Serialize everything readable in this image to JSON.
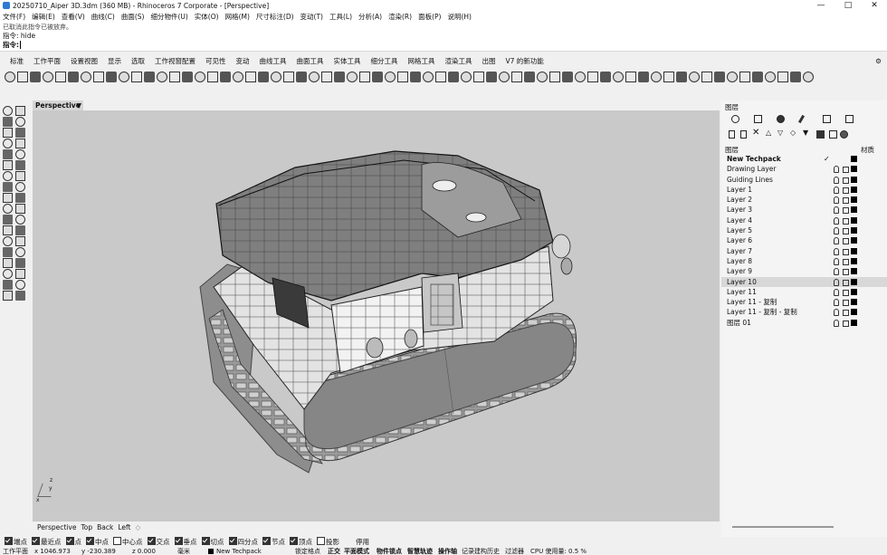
{
  "window": {
    "title": "20250710_Aiper 3D.3dm (360 MB) - Rhinoceros 7 Corporate - [Perspective]",
    "minimize": "—",
    "maximize": "□",
    "close": "✕"
  },
  "menu": [
    "文件(F)",
    "编辑(E)",
    "查看(V)",
    "曲线(C)",
    "曲面(S)",
    "细分物件(U)",
    "实体(O)",
    "网格(M)",
    "尺寸标注(D)",
    "变动(T)",
    "工具(L)",
    "分析(A)",
    "渲染(R)",
    "面板(P)",
    "说明(H)"
  ],
  "command": {
    "history": "已取消此指令已被放弃。",
    "last_label": "指令:",
    "last_value": "hide",
    "prompt_label": "指令:",
    "prompt_value": ""
  },
  "toolbar_tabs": [
    "标准",
    "工作平面",
    "设置视图",
    "显示",
    "选取",
    "工作视窗配置",
    "可见性",
    "变动",
    "曲线工具",
    "曲面工具",
    "实体工具",
    "细分工具",
    "网格工具",
    "渲染工具",
    "出图",
    "V7 的新功能"
  ],
  "toolbar_tabs_gear": "⚙",
  "viewport": {
    "active_name": "Perspective",
    "tab_arrow": "▼",
    "axis_x": "x",
    "axis_y": "y",
    "axis_z": "z",
    "tabs": [
      "Perspective",
      "Top",
      "Back",
      "Left"
    ],
    "add_tab": "◇"
  },
  "osnap": [
    {
      "label": "端点",
      "checked": true
    },
    {
      "label": "最近点",
      "checked": true
    },
    {
      "label": "点",
      "checked": true
    },
    {
      "label": "中点",
      "checked": true
    },
    {
      "label": "中心点",
      "checked": false
    },
    {
      "label": "交点",
      "checked": true
    },
    {
      "label": "垂点",
      "checked": true
    },
    {
      "label": "切点",
      "checked": true
    },
    {
      "label": "四分点",
      "checked": true
    },
    {
      "label": "节点",
      "checked": true
    },
    {
      "label": "顶点",
      "checked": true
    },
    {
      "label": "投影",
      "checked": false
    }
  ],
  "osnap_disable": "停用",
  "status": {
    "cplane": "工作平面",
    "x": "x 1046.973",
    "y": "y -230.389",
    "z": "z 0.000",
    "units": "毫米",
    "layer": "New Techpack",
    "grid_snap": "锁定格点",
    "ortho": "正交",
    "planar": "平面模式",
    "osnap_label": "物件锁点",
    "smart_track": "智慧轨迹",
    "gumball": "操作轴",
    "history": "记录建构历史",
    "filter": "过滤器",
    "cpu": "CPU 使用量: 0.5 %"
  },
  "layer_panel": {
    "title": "图层",
    "list_header": "图层",
    "material_header": "材质",
    "current_mark": "✓",
    "layers": [
      {
        "name": "New Techpack",
        "current": true,
        "selected": false
      },
      {
        "name": "Drawing Layer",
        "current": false,
        "selected": false
      },
      {
        "name": "Guiding Lines",
        "current": false,
        "selected": false
      },
      {
        "name": "Layer 1",
        "current": false,
        "selected": false
      },
      {
        "name": "Layer 2",
        "current": false,
        "selected": false
      },
      {
        "name": "Layer 3",
        "current": false,
        "selected": false
      },
      {
        "name": "Layer 4",
        "current": false,
        "selected": false
      },
      {
        "name": "Layer 5",
        "current": false,
        "selected": false
      },
      {
        "name": "Layer 6",
        "current": false,
        "selected": false
      },
      {
        "name": "Layer 7",
        "current": false,
        "selected": false
      },
      {
        "name": "Layer 8",
        "current": false,
        "selected": false
      },
      {
        "name": "Layer 9",
        "current": false,
        "selected": false
      },
      {
        "name": "Layer 10",
        "current": false,
        "selected": true
      },
      {
        "name": "Layer 11",
        "current": false,
        "selected": false
      },
      {
        "name": "Layer 11 - 复制",
        "current": false,
        "selected": false
      },
      {
        "name": "Layer 11 - 复制 - 复制",
        "current": false,
        "selected": false
      },
      {
        "name": "图层 01",
        "current": false,
        "selected": false
      }
    ]
  },
  "colors": {
    "viewport_bg": "#c9c9c9",
    "selected_row": "#d8d8d8",
    "layer_color": "#000000"
  }
}
